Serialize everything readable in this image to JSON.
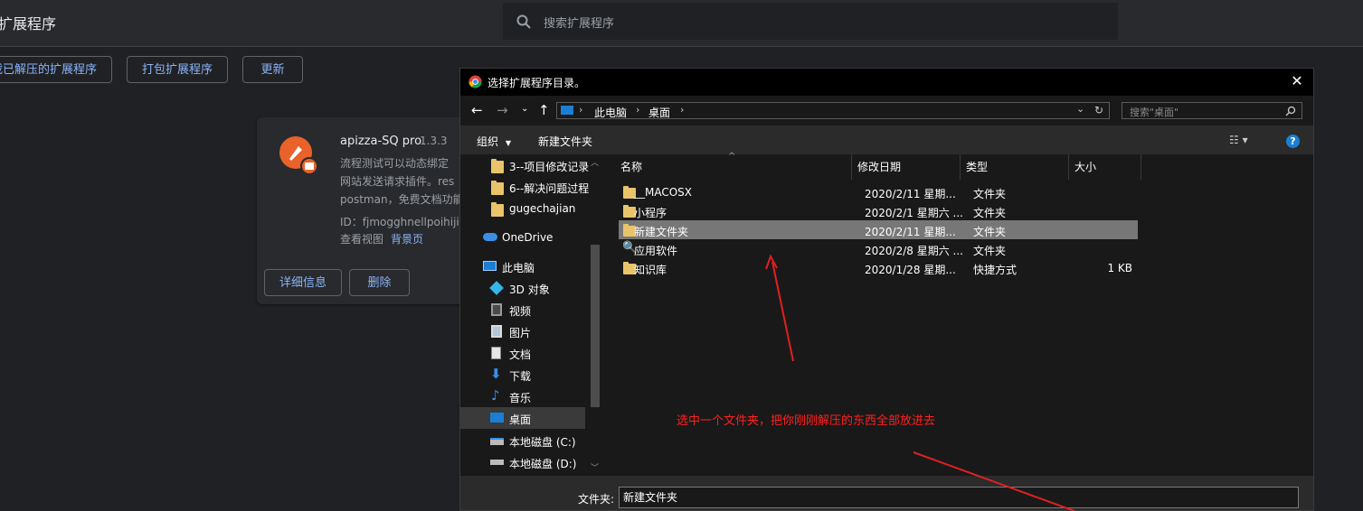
{
  "page": {
    "title": "扩展程序",
    "search_placeholder": "搜索扩展程序",
    "buttons": {
      "load_unpacked": "加载已解压的扩展程序",
      "pack": "打包扩展程序",
      "update": "更新"
    }
  },
  "extension": {
    "name": "apizza-SQ pro",
    "version": "1.3.3",
    "description_lines": [
      "流程测试可以动态绑定",
      "网站发送请求插件。res",
      "postman，免费文档功能"
    ],
    "id": "ID：fjmogghnellpoihijip",
    "view_label": "查看视图",
    "view_link": "背景页",
    "details_button": "详细信息",
    "remove_button": "删除"
  },
  "dialog": {
    "title": "选择扩展程序目录。",
    "breadcrumb": [
      "此电脑",
      "桌面"
    ],
    "search_placeholder": "搜索\"桌面\"",
    "organize": "组织",
    "new_folder": "新建文件夹",
    "nav_items": [
      {
        "label": "3--项目修改记录",
        "icon": "folder-icon"
      },
      {
        "label": "6--解决问题过程",
        "icon": "folder-icon"
      },
      {
        "label": "gugechajian",
        "icon": "folder-icon"
      },
      {
        "label": "OneDrive",
        "icon": "cloud-icon"
      },
      {
        "label": "此电脑",
        "icon": "computer-icon"
      },
      {
        "label": "3D 对象",
        "icon": "cube-icon"
      },
      {
        "label": "视频",
        "icon": "video-icon"
      },
      {
        "label": "图片",
        "icon": "picture-icon"
      },
      {
        "label": "文档",
        "icon": "document-icon"
      },
      {
        "label": "下载",
        "icon": "download-icon"
      },
      {
        "label": "音乐",
        "icon": "music-icon"
      },
      {
        "label": "桌面",
        "icon": "desktop-icon"
      },
      {
        "label": "本地磁盘 (C:)",
        "icon": "drive-icon"
      },
      {
        "label": "本地磁盘 (D:)",
        "icon": "drive-icon"
      }
    ],
    "columns": [
      "名称",
      "修改日期",
      "类型",
      "大小"
    ],
    "files": [
      {
        "name": "__MACOSX",
        "date": "2020/2/11 星期...",
        "type": "文件夹",
        "size": ""
      },
      {
        "name": "小程序",
        "date": "2020/2/1 星期六 ...",
        "type": "文件夹",
        "size": ""
      },
      {
        "name": "新建文件夹",
        "date": "2020/2/11 星期...",
        "type": "文件夹",
        "size": "",
        "selected": true
      },
      {
        "name": "应用软件",
        "date": "2020/2/8 星期六 ...",
        "type": "文件夹",
        "size": ""
      },
      {
        "name": "知识库",
        "date": "2020/1/28 星期...",
        "type": "快捷方式",
        "size": "1 KB"
      }
    ],
    "folder_label": "文件夹:",
    "folder_value": "新建文件夹"
  },
  "annotation": "选中一个文件夹，把你刚刚解压的东西全部放进去",
  "colors": {
    "accent": "#8ab4f8",
    "annotation": "#ff2020",
    "selected_row": "#777777"
  }
}
